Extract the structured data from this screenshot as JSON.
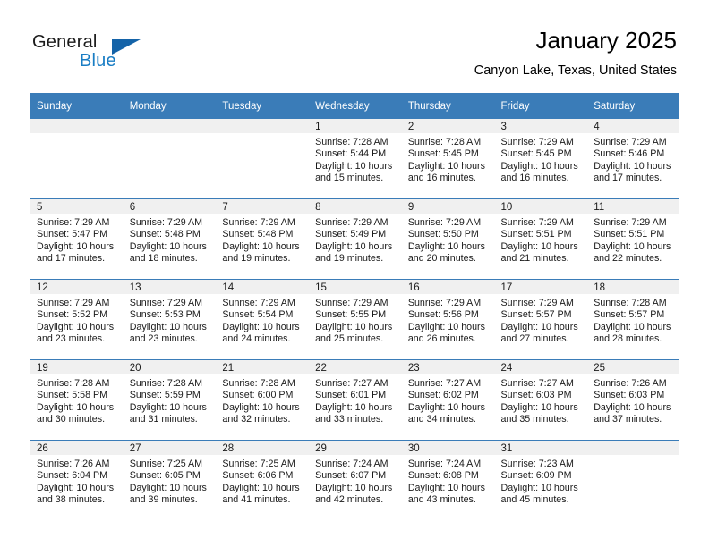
{
  "brand": {
    "name_part1": "General",
    "name_part2": "Blue",
    "accent_color": "#1a7dc4",
    "triangle_color": "#1463a8"
  },
  "header": {
    "title": "January 2025",
    "subtitle": "Canyon Lake, Texas, United States"
  },
  "calendar": {
    "header_bg": "#3a7cb8",
    "daynum_bg": "#f0f0f0",
    "weekday_headers": [
      "Sunday",
      "Monday",
      "Tuesday",
      "Wednesday",
      "Thursday",
      "Friday",
      "Saturday"
    ],
    "weeks": [
      [
        {
          "day": "",
          "sunrise": "",
          "sunset": "",
          "daylight": ""
        },
        {
          "day": "",
          "sunrise": "",
          "sunset": "",
          "daylight": ""
        },
        {
          "day": "",
          "sunrise": "",
          "sunset": "",
          "daylight": ""
        },
        {
          "day": "1",
          "sunrise": "Sunrise: 7:28 AM",
          "sunset": "Sunset: 5:44 PM",
          "daylight": "Daylight: 10 hours and 15 minutes."
        },
        {
          "day": "2",
          "sunrise": "Sunrise: 7:28 AM",
          "sunset": "Sunset: 5:45 PM",
          "daylight": "Daylight: 10 hours and 16 minutes."
        },
        {
          "day": "3",
          "sunrise": "Sunrise: 7:29 AM",
          "sunset": "Sunset: 5:45 PM",
          "daylight": "Daylight: 10 hours and 16 minutes."
        },
        {
          "day": "4",
          "sunrise": "Sunrise: 7:29 AM",
          "sunset": "Sunset: 5:46 PM",
          "daylight": "Daylight: 10 hours and 17 minutes."
        }
      ],
      [
        {
          "day": "5",
          "sunrise": "Sunrise: 7:29 AM",
          "sunset": "Sunset: 5:47 PM",
          "daylight": "Daylight: 10 hours and 17 minutes."
        },
        {
          "day": "6",
          "sunrise": "Sunrise: 7:29 AM",
          "sunset": "Sunset: 5:48 PM",
          "daylight": "Daylight: 10 hours and 18 minutes."
        },
        {
          "day": "7",
          "sunrise": "Sunrise: 7:29 AM",
          "sunset": "Sunset: 5:48 PM",
          "daylight": "Daylight: 10 hours and 19 minutes."
        },
        {
          "day": "8",
          "sunrise": "Sunrise: 7:29 AM",
          "sunset": "Sunset: 5:49 PM",
          "daylight": "Daylight: 10 hours and 19 minutes."
        },
        {
          "day": "9",
          "sunrise": "Sunrise: 7:29 AM",
          "sunset": "Sunset: 5:50 PM",
          "daylight": "Daylight: 10 hours and 20 minutes."
        },
        {
          "day": "10",
          "sunrise": "Sunrise: 7:29 AM",
          "sunset": "Sunset: 5:51 PM",
          "daylight": "Daylight: 10 hours and 21 minutes."
        },
        {
          "day": "11",
          "sunrise": "Sunrise: 7:29 AM",
          "sunset": "Sunset: 5:51 PM",
          "daylight": "Daylight: 10 hours and 22 minutes."
        }
      ],
      [
        {
          "day": "12",
          "sunrise": "Sunrise: 7:29 AM",
          "sunset": "Sunset: 5:52 PM",
          "daylight": "Daylight: 10 hours and 23 minutes."
        },
        {
          "day": "13",
          "sunrise": "Sunrise: 7:29 AM",
          "sunset": "Sunset: 5:53 PM",
          "daylight": "Daylight: 10 hours and 23 minutes."
        },
        {
          "day": "14",
          "sunrise": "Sunrise: 7:29 AM",
          "sunset": "Sunset: 5:54 PM",
          "daylight": "Daylight: 10 hours and 24 minutes."
        },
        {
          "day": "15",
          "sunrise": "Sunrise: 7:29 AM",
          "sunset": "Sunset: 5:55 PM",
          "daylight": "Daylight: 10 hours and 25 minutes."
        },
        {
          "day": "16",
          "sunrise": "Sunrise: 7:29 AM",
          "sunset": "Sunset: 5:56 PM",
          "daylight": "Daylight: 10 hours and 26 minutes."
        },
        {
          "day": "17",
          "sunrise": "Sunrise: 7:29 AM",
          "sunset": "Sunset: 5:57 PM",
          "daylight": "Daylight: 10 hours and 27 minutes."
        },
        {
          "day": "18",
          "sunrise": "Sunrise: 7:28 AM",
          "sunset": "Sunset: 5:57 PM",
          "daylight": "Daylight: 10 hours and 28 minutes."
        }
      ],
      [
        {
          "day": "19",
          "sunrise": "Sunrise: 7:28 AM",
          "sunset": "Sunset: 5:58 PM",
          "daylight": "Daylight: 10 hours and 30 minutes."
        },
        {
          "day": "20",
          "sunrise": "Sunrise: 7:28 AM",
          "sunset": "Sunset: 5:59 PM",
          "daylight": "Daylight: 10 hours and 31 minutes."
        },
        {
          "day": "21",
          "sunrise": "Sunrise: 7:28 AM",
          "sunset": "Sunset: 6:00 PM",
          "daylight": "Daylight: 10 hours and 32 minutes."
        },
        {
          "day": "22",
          "sunrise": "Sunrise: 7:27 AM",
          "sunset": "Sunset: 6:01 PM",
          "daylight": "Daylight: 10 hours and 33 minutes."
        },
        {
          "day": "23",
          "sunrise": "Sunrise: 7:27 AM",
          "sunset": "Sunset: 6:02 PM",
          "daylight": "Daylight: 10 hours and 34 minutes."
        },
        {
          "day": "24",
          "sunrise": "Sunrise: 7:27 AM",
          "sunset": "Sunset: 6:03 PM",
          "daylight": "Daylight: 10 hours and 35 minutes."
        },
        {
          "day": "25",
          "sunrise": "Sunrise: 7:26 AM",
          "sunset": "Sunset: 6:03 PM",
          "daylight": "Daylight: 10 hours and 37 minutes."
        }
      ],
      [
        {
          "day": "26",
          "sunrise": "Sunrise: 7:26 AM",
          "sunset": "Sunset: 6:04 PM",
          "daylight": "Daylight: 10 hours and 38 minutes."
        },
        {
          "day": "27",
          "sunrise": "Sunrise: 7:25 AM",
          "sunset": "Sunset: 6:05 PM",
          "daylight": "Daylight: 10 hours and 39 minutes."
        },
        {
          "day": "28",
          "sunrise": "Sunrise: 7:25 AM",
          "sunset": "Sunset: 6:06 PM",
          "daylight": "Daylight: 10 hours and 41 minutes."
        },
        {
          "day": "29",
          "sunrise": "Sunrise: 7:24 AM",
          "sunset": "Sunset: 6:07 PM",
          "daylight": "Daylight: 10 hours and 42 minutes."
        },
        {
          "day": "30",
          "sunrise": "Sunrise: 7:24 AM",
          "sunset": "Sunset: 6:08 PM",
          "daylight": "Daylight: 10 hours and 43 minutes."
        },
        {
          "day": "31",
          "sunrise": "Sunrise: 7:23 AM",
          "sunset": "Sunset: 6:09 PM",
          "daylight": "Daylight: 10 hours and 45 minutes."
        },
        {
          "day": "",
          "sunrise": "",
          "sunset": "",
          "daylight": ""
        }
      ]
    ]
  }
}
